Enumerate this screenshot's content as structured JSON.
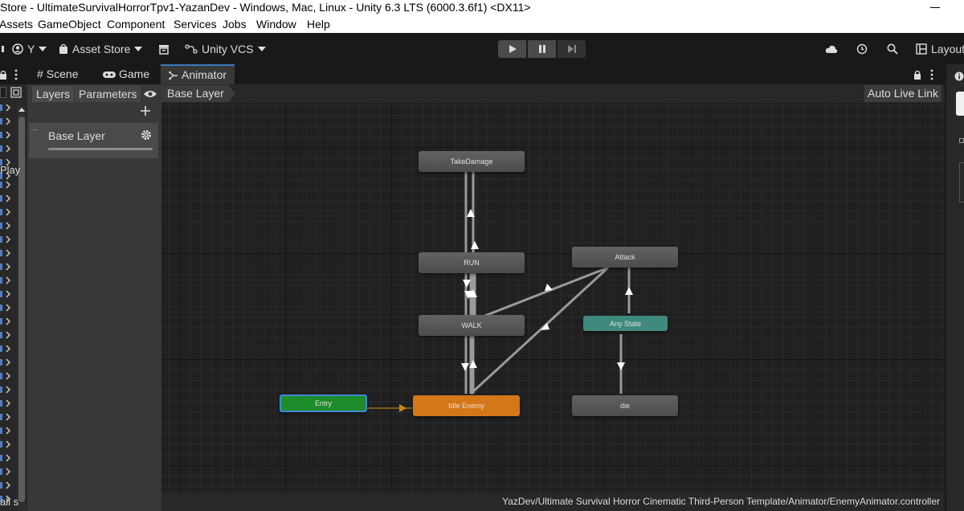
{
  "window": {
    "title": "Store - UltimateSurvivalHorrorTpv1-YazanDev - Windows, Mac, Linux - Unity 6.3 LTS (6000.3.6f1) <DX11>"
  },
  "menu": [
    "Assets",
    "GameObject",
    "Component",
    "Services",
    "Jobs",
    "Window",
    "Help"
  ],
  "toolbar": {
    "account_label": "Y",
    "asset_store_label": "Asset Store",
    "vcs_label": "Unity VCS",
    "layout_label": "Layout"
  },
  "tabs": [
    {
      "label": "Scene",
      "icon": "hash-icon"
    },
    {
      "label": "Game",
      "icon": "gamepad-icon"
    },
    {
      "label": "Animator",
      "icon": "animator-icon"
    }
  ],
  "left_strip": {
    "play_label": "Play",
    "bottom_label": "all s"
  },
  "animator": {
    "layers_tab": "Layers",
    "parameters_tab": "Parameters",
    "breadcrumb": "Base Layer",
    "auto_live_link": "Auto Live Link",
    "layer_name": "Base Layer",
    "path": "YazDev/Ultimate Survival Horror Cinematic Third-Person Template/Animator/EnemyAnimator.controller"
  },
  "states": [
    {
      "id": "takedamage",
      "label": "TakeDamage"
    },
    {
      "id": "run",
      "label": "RUN"
    },
    {
      "id": "attack",
      "label": "Attack"
    },
    {
      "id": "walk",
      "label": "WALK"
    },
    {
      "id": "anystate",
      "label": "Any State"
    },
    {
      "id": "entry",
      "label": "Entry"
    },
    {
      "id": "idle",
      "label": "Idle Enemy"
    },
    {
      "id": "die",
      "label": "die"
    }
  ],
  "colors": {
    "entry": "#1e8c2a",
    "entry_border": "#3e8ad6",
    "idle": "#d47718",
    "anystate": "#3f8a7c",
    "grey_state": "#595959",
    "tab_accent": "#3a79bb"
  }
}
